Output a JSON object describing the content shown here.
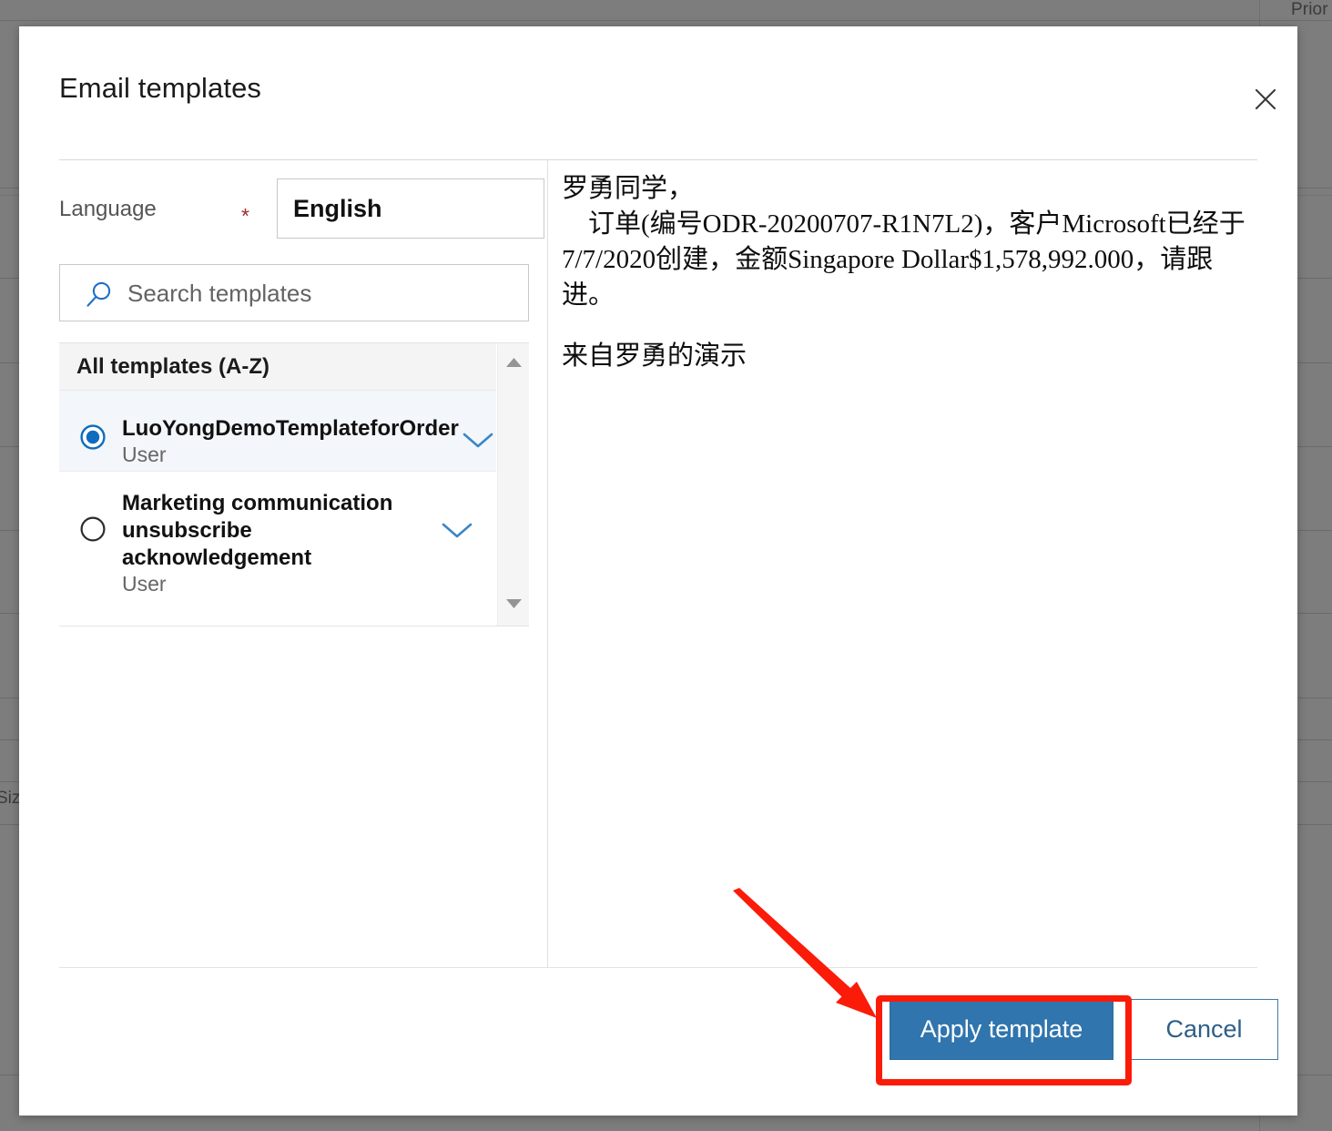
{
  "background": {
    "header_text_fragment": "Prior",
    "left_text_fragment": "Siz"
  },
  "dialog": {
    "title": "Email templates",
    "close_icon": "close-icon"
  },
  "left_panel": {
    "language_label": "Language",
    "required_marker": "*",
    "language_value": "English",
    "search": {
      "icon": "search-icon",
      "placeholder": "Search templates",
      "value": ""
    },
    "list_group_header": "All templates (A-Z)",
    "templates": [
      {
        "title": "LuoYongDemoTemplateforOrder",
        "subtitle": "User",
        "selected": true,
        "expand_icon": "chevron-down-icon"
      },
      {
        "title": "Marketing communication unsubscribe acknowledgement",
        "subtitle": "User",
        "selected": false,
        "expand_icon": "chevron-down-icon"
      }
    ],
    "scrollbar": {
      "up_icon": "caret-up-icon",
      "down_icon": "caret-down-icon"
    }
  },
  "preview": {
    "body": "罗勇同学，\n    订单(编号ODR-20200707-R1N7L2)，客户Microsoft已经于7/7/2020创建，金额Singapore Dollar$1,578,992.000，请跟进。",
    "signature": "来自罗勇的演示"
  },
  "footer": {
    "apply_label": "Apply template",
    "cancel_label": "Cancel"
  },
  "annotation": {
    "color": "#fb1b09",
    "target": "apply-template-button"
  },
  "colors": {
    "primary_button": "#3075ad",
    "cancel_text": "#2d5f88",
    "accent_blue": "#0f6cbd",
    "required_red": "#a4262c",
    "annotation_red": "#fb1b09",
    "selected_row": "#f3f6fa"
  }
}
